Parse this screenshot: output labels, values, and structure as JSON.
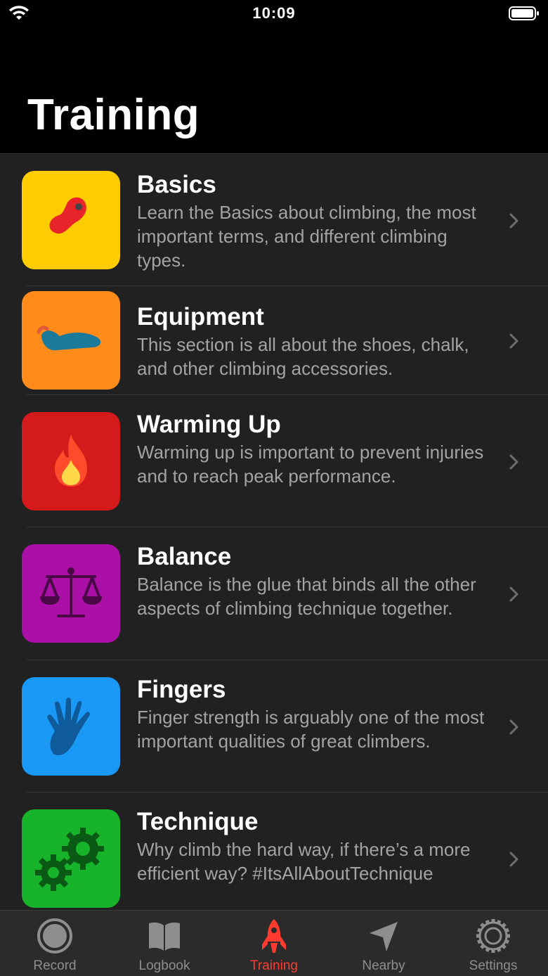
{
  "status": {
    "time": "10:09"
  },
  "page": {
    "title": "Training"
  },
  "items": [
    {
      "title": "Basics",
      "description": "Learn the Basics about climbing, the most important terms, and different climbing types.",
      "icon": "climbing-hold-icon",
      "color": "#ffcc00"
    },
    {
      "title": "Equipment",
      "description": "This section is all about the shoes, chalk, and other climbing accessories.",
      "icon": "climbing-shoe-icon",
      "color": "#ff8c1a"
    },
    {
      "title": "Warming Up",
      "description": "Warming up is important to prevent injuries and to reach peak performance.",
      "icon": "flame-icon",
      "color": "#d41a1a"
    },
    {
      "title": "Balance",
      "description": "Balance is the glue that binds all the other aspects of climbing technique together.",
      "icon": "scales-icon",
      "color": "#aa10a6"
    },
    {
      "title": "Fingers",
      "description": "Finger strength is arguably one of the most important qualities of great climbers.",
      "icon": "hand-icon",
      "color": "#1a98f5"
    },
    {
      "title": "Technique",
      "description": "Why climb the hard way, if there’s a more efficient way? #ItsAllAboutTechnique",
      "icon": "gears-icon",
      "color": "#17b32a"
    }
  ],
  "tabs": [
    {
      "label": "Record",
      "icon": "record-icon",
      "active": false
    },
    {
      "label": "Logbook",
      "icon": "book-icon",
      "active": false
    },
    {
      "label": "Training",
      "icon": "rocket-icon",
      "active": true
    },
    {
      "label": "Nearby",
      "icon": "location-arrow-icon",
      "active": false
    },
    {
      "label": "Settings",
      "icon": "gear-icon",
      "active": false
    }
  ],
  "colors": {
    "accent": "#ff3b30",
    "background": "#000000",
    "list_background": "#212121"
  }
}
